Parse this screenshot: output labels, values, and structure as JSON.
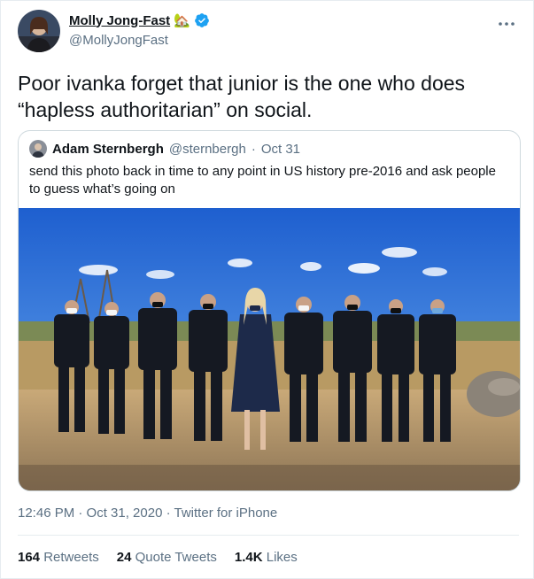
{
  "tweet": {
    "author_name": "Molly Jong-Fast",
    "author_emoji": "🏡",
    "author_handle": "@MollyJongFast",
    "text": "Poor ivanka forget that junior is the one who does “hapless authoritarian” on social.",
    "timestamp": "12:46 PM · Oct 31, 2020",
    "source": "Twitter for iPhone"
  },
  "quoted": {
    "author_name": "Adam Sternbergh",
    "author_handle": "@sternbergh",
    "separator": "·",
    "date": "Oct 31",
    "text": "send this photo back in time to any point in US history pre-2016 and ask people to guess what’s going on"
  },
  "stats": [
    {
      "count": "164",
      "label": "Retweets"
    },
    {
      "count": "24",
      "label": "Quote Tweets"
    },
    {
      "count": "1.4K",
      "label": "Likes"
    }
  ],
  "colors": {
    "verified": "#1da1f2",
    "muted": "#5b7083",
    "text": "#0f1419"
  },
  "icons": {
    "verified": "verified-badge-icon",
    "more": "more-options-icon"
  }
}
